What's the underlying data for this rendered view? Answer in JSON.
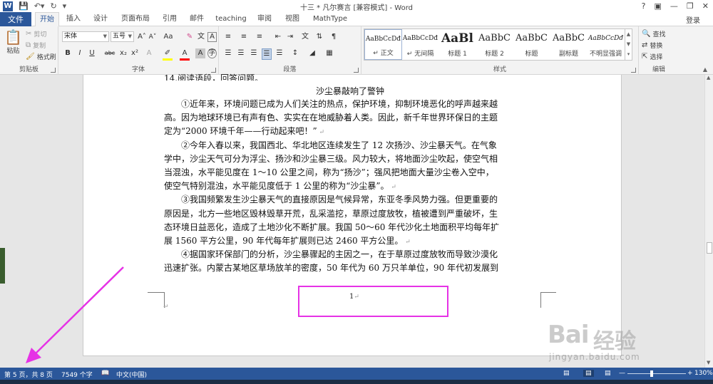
{
  "window": {
    "title": "十三 * 凡尔赛言 [兼容模式] - Word",
    "help": "?",
    "sign_in": "登录"
  },
  "tabs": [
    "文件",
    "开始",
    "插入",
    "设计",
    "页面布局",
    "引用",
    "邮件",
    "teaching",
    "审阅",
    "视图",
    "MathType"
  ],
  "active_tab": "开始",
  "ribbon": {
    "clipboard": {
      "paste": "粘贴",
      "cut": "剪切",
      "copy": "复制",
      "format_painter": "格式刷",
      "group": "剪贴板"
    },
    "font": {
      "name": "宋体",
      "size": "五号",
      "grow": "A˄",
      "shrink": "A˅",
      "case": "Aa",
      "bold": "B",
      "italic": "I",
      "underline": "U",
      "strike": "abc",
      "subscript": "x₂",
      "superscript": "x²",
      "group": "字体"
    },
    "paragraph": {
      "group": "段落"
    },
    "styles": {
      "items": [
        {
          "preview": "AaBbCcDđ",
          "name": "↵ 正文",
          "size": 9
        },
        {
          "preview": "AaBbCcDđ",
          "name": "↵ 无间隔",
          "size": 9
        },
        {
          "preview": "AaBl",
          "name": "标题 1",
          "size": 17
        },
        {
          "preview": "AaBbC",
          "name": "标题 2",
          "size": 13
        },
        {
          "preview": "AaBbC",
          "name": "标题",
          "size": 13
        },
        {
          "preview": "AaBbC",
          "name": "副标题",
          "size": 13
        },
        {
          "preview": "AaBbCcDđ",
          "name": "不明显强调",
          "size": 9
        }
      ],
      "group": "样式"
    },
    "editing": {
      "find": "查找",
      "replace": "替换",
      "select": "选择",
      "group": "编辑"
    }
  },
  "document": {
    "cut_line": "14.阅读语段，回答问题。",
    "title": "沙尘暴敲响了警钟",
    "lines": [
      "　　①近年来，环境问题已成为人们关注的热点，保护环境，抑制环境恶化的呼声越来越",
      "高。因为地球环境已有声有色、实实在在地威胁着人类。因此，新千年世界环保日的主题",
      "定为“2000 环境千年——行动起来吧！”",
      "　　②今年入春以来，我国西北、华北地区连续发生了 12 次扬沙、沙尘暴天气。在气象",
      "学中，沙尘天气可分为浮尘、扬沙和沙尘暴三级。风力较大，将地面沙尘吹起，使空气相",
      "当混浊，水平能见度在 1～10 公里之间，称为“扬沙”；强风把地面大量沙尘卷入空中，",
      "使空气特别混浊，水平能见度低于 1 公里的称为“沙尘暴”。",
      "　　③我国频繁发生沙尘暴天气的直接原因是气候异常，东亚冬季风势力强。但更重要的",
      "原因是，北方一些地区毁林毁草开荒，乱采滥挖，草原过度放牧，植被遭到严重破坏，生",
      "态环境日益恶化，造成了土地沙化不断扩展。我国 50～60 年代沙化土地面积平均每年扩",
      "展 1560 平方公里，90 年代每年扩展则已达 2460 平方公里。",
      "　　④据国家环保部门的分析，沙尘暴骤起的主因之一，在于草原过度放牧而导致沙漠化",
      "迅速扩张。内蒙古某地区草场放羊的密度，50 年代为 60 万只羊单位，90 年代初发展到"
    ],
    "page_number": "1"
  },
  "statusbar": {
    "page": "第 5 页，共 8 页",
    "words": "7549 个字",
    "language": "中文(中国)",
    "zoom": "130%"
  },
  "watermark": {
    "logo": "Bai",
    "text": "经验",
    "url": "jingyan.baidu.com"
  },
  "annotation_color": "#e632e6",
  "accent": "#2b579a"
}
